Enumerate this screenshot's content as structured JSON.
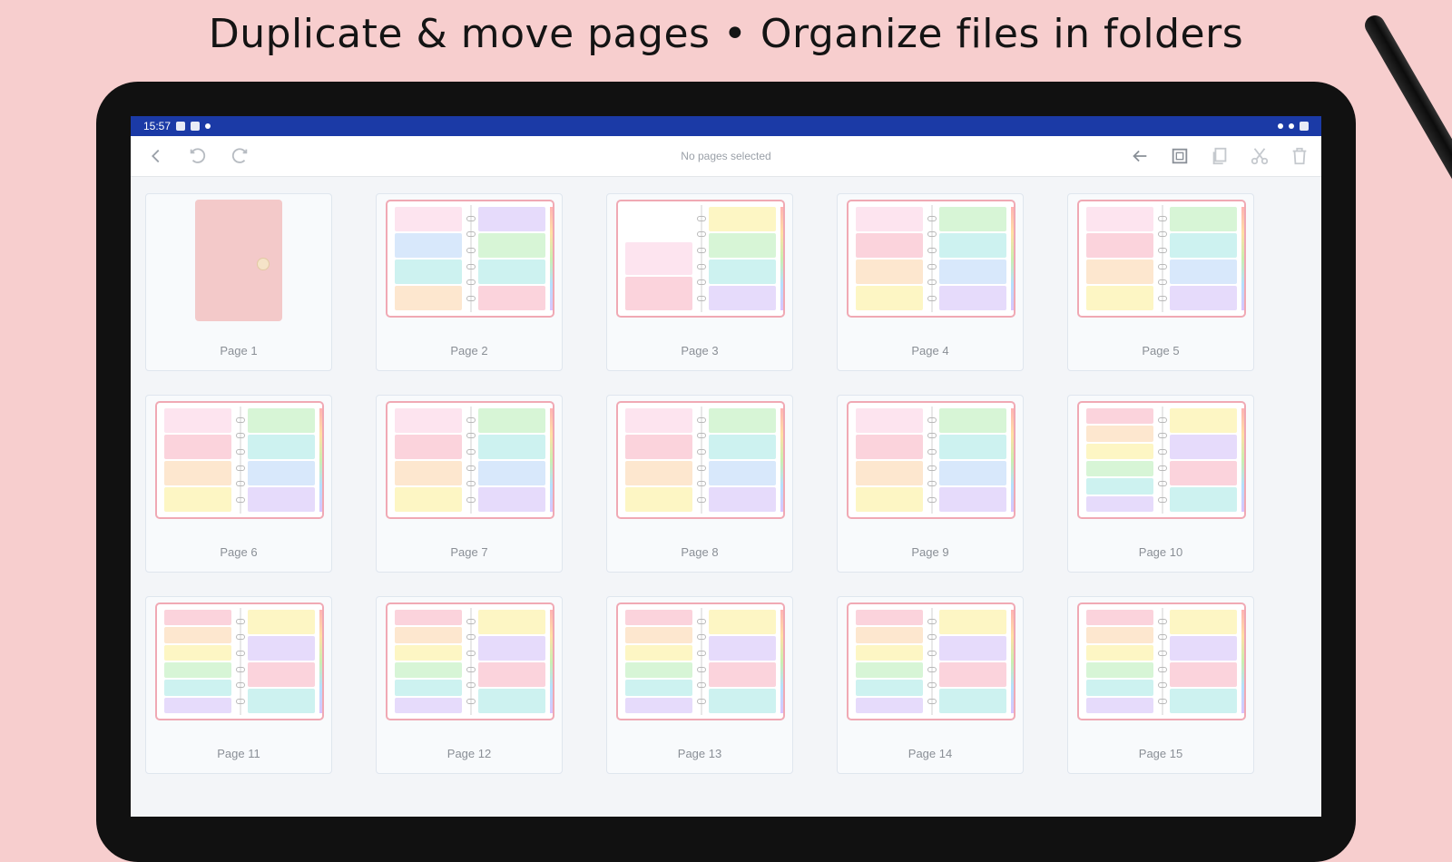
{
  "headline": "Duplicate & move pages • Organize files in folders",
  "status_bar": {
    "time": "15:57"
  },
  "toolbar": {
    "title": "No pages selected"
  },
  "colors": {
    "background": "#f7cece",
    "status_bar": "#1b3aa6",
    "accent_border": "#f0a9b4"
  },
  "pages": [
    {
      "label": "Page 1",
      "kind": "cover"
    },
    {
      "label": "Page 2",
      "kind": "calendar"
    },
    {
      "label": "Page 3",
      "kind": "columns"
    },
    {
      "label": "Page 4",
      "kind": "blocks"
    },
    {
      "label": "Page 5",
      "kind": "blocks"
    },
    {
      "label": "Page 6",
      "kind": "blocks"
    },
    {
      "label": "Page 7",
      "kind": "blocks"
    },
    {
      "label": "Page 8",
      "kind": "blocks"
    },
    {
      "label": "Page 9",
      "kind": "blocks"
    },
    {
      "label": "Page 10",
      "kind": "mixed"
    },
    {
      "label": "Page 11",
      "kind": "mixed"
    },
    {
      "label": "Page 12",
      "kind": "mixed"
    },
    {
      "label": "Page 13",
      "kind": "mixed"
    },
    {
      "label": "Page 14",
      "kind": "mixed"
    },
    {
      "label": "Page 15",
      "kind": "mixed"
    }
  ]
}
